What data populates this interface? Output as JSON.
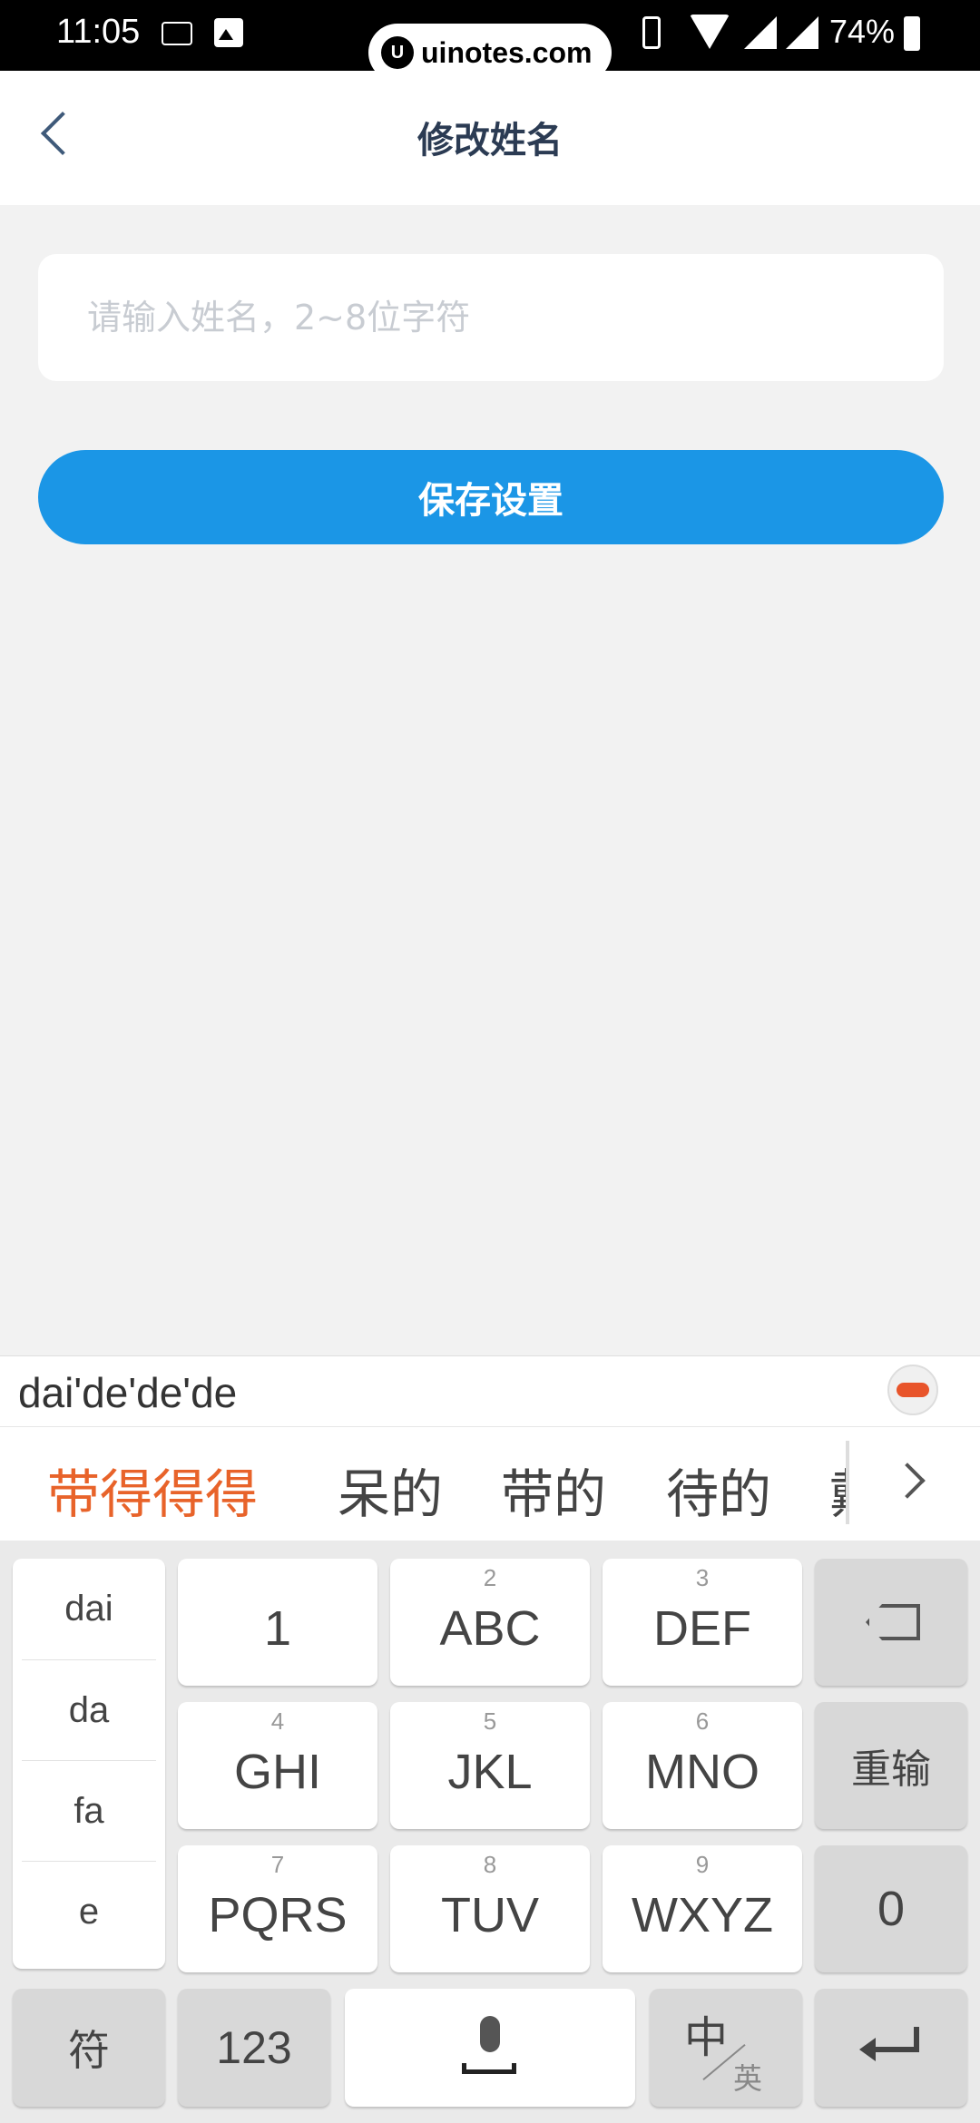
{
  "status_bar": {
    "time": "11:05",
    "battery": "74%",
    "watermark": "uinotes.com",
    "watermark_logo": "U"
  },
  "header": {
    "title": "修改姓名"
  },
  "form": {
    "name_placeholder": "请输入姓名，2~8位字符",
    "save_label": "保存设置"
  },
  "ime": {
    "composition": "dai'de'de'de",
    "candidates": [
      "带得得得",
      "呆的",
      "带的",
      "待的",
      "戴"
    ],
    "pinyin_options": [
      "dai",
      "da",
      "fa",
      "e"
    ],
    "keys": {
      "k1": "1",
      "k2_sub": "2",
      "k2": "ABC",
      "k3_sub": "3",
      "k3": "DEF",
      "k4_sub": "4",
      "k4": "GHI",
      "k5_sub": "5",
      "k5": "JKL",
      "k6_sub": "6",
      "k6": "MNO",
      "k7_sub": "7",
      "k7": "PQRS",
      "k8_sub": "8",
      "k8": "TUV",
      "k9_sub": "9",
      "k9": "WXYZ",
      "reset": "重输",
      "zero": "0",
      "symbol": "符",
      "numeric": "123",
      "lang_zh": "中",
      "lang_en": "英"
    }
  }
}
